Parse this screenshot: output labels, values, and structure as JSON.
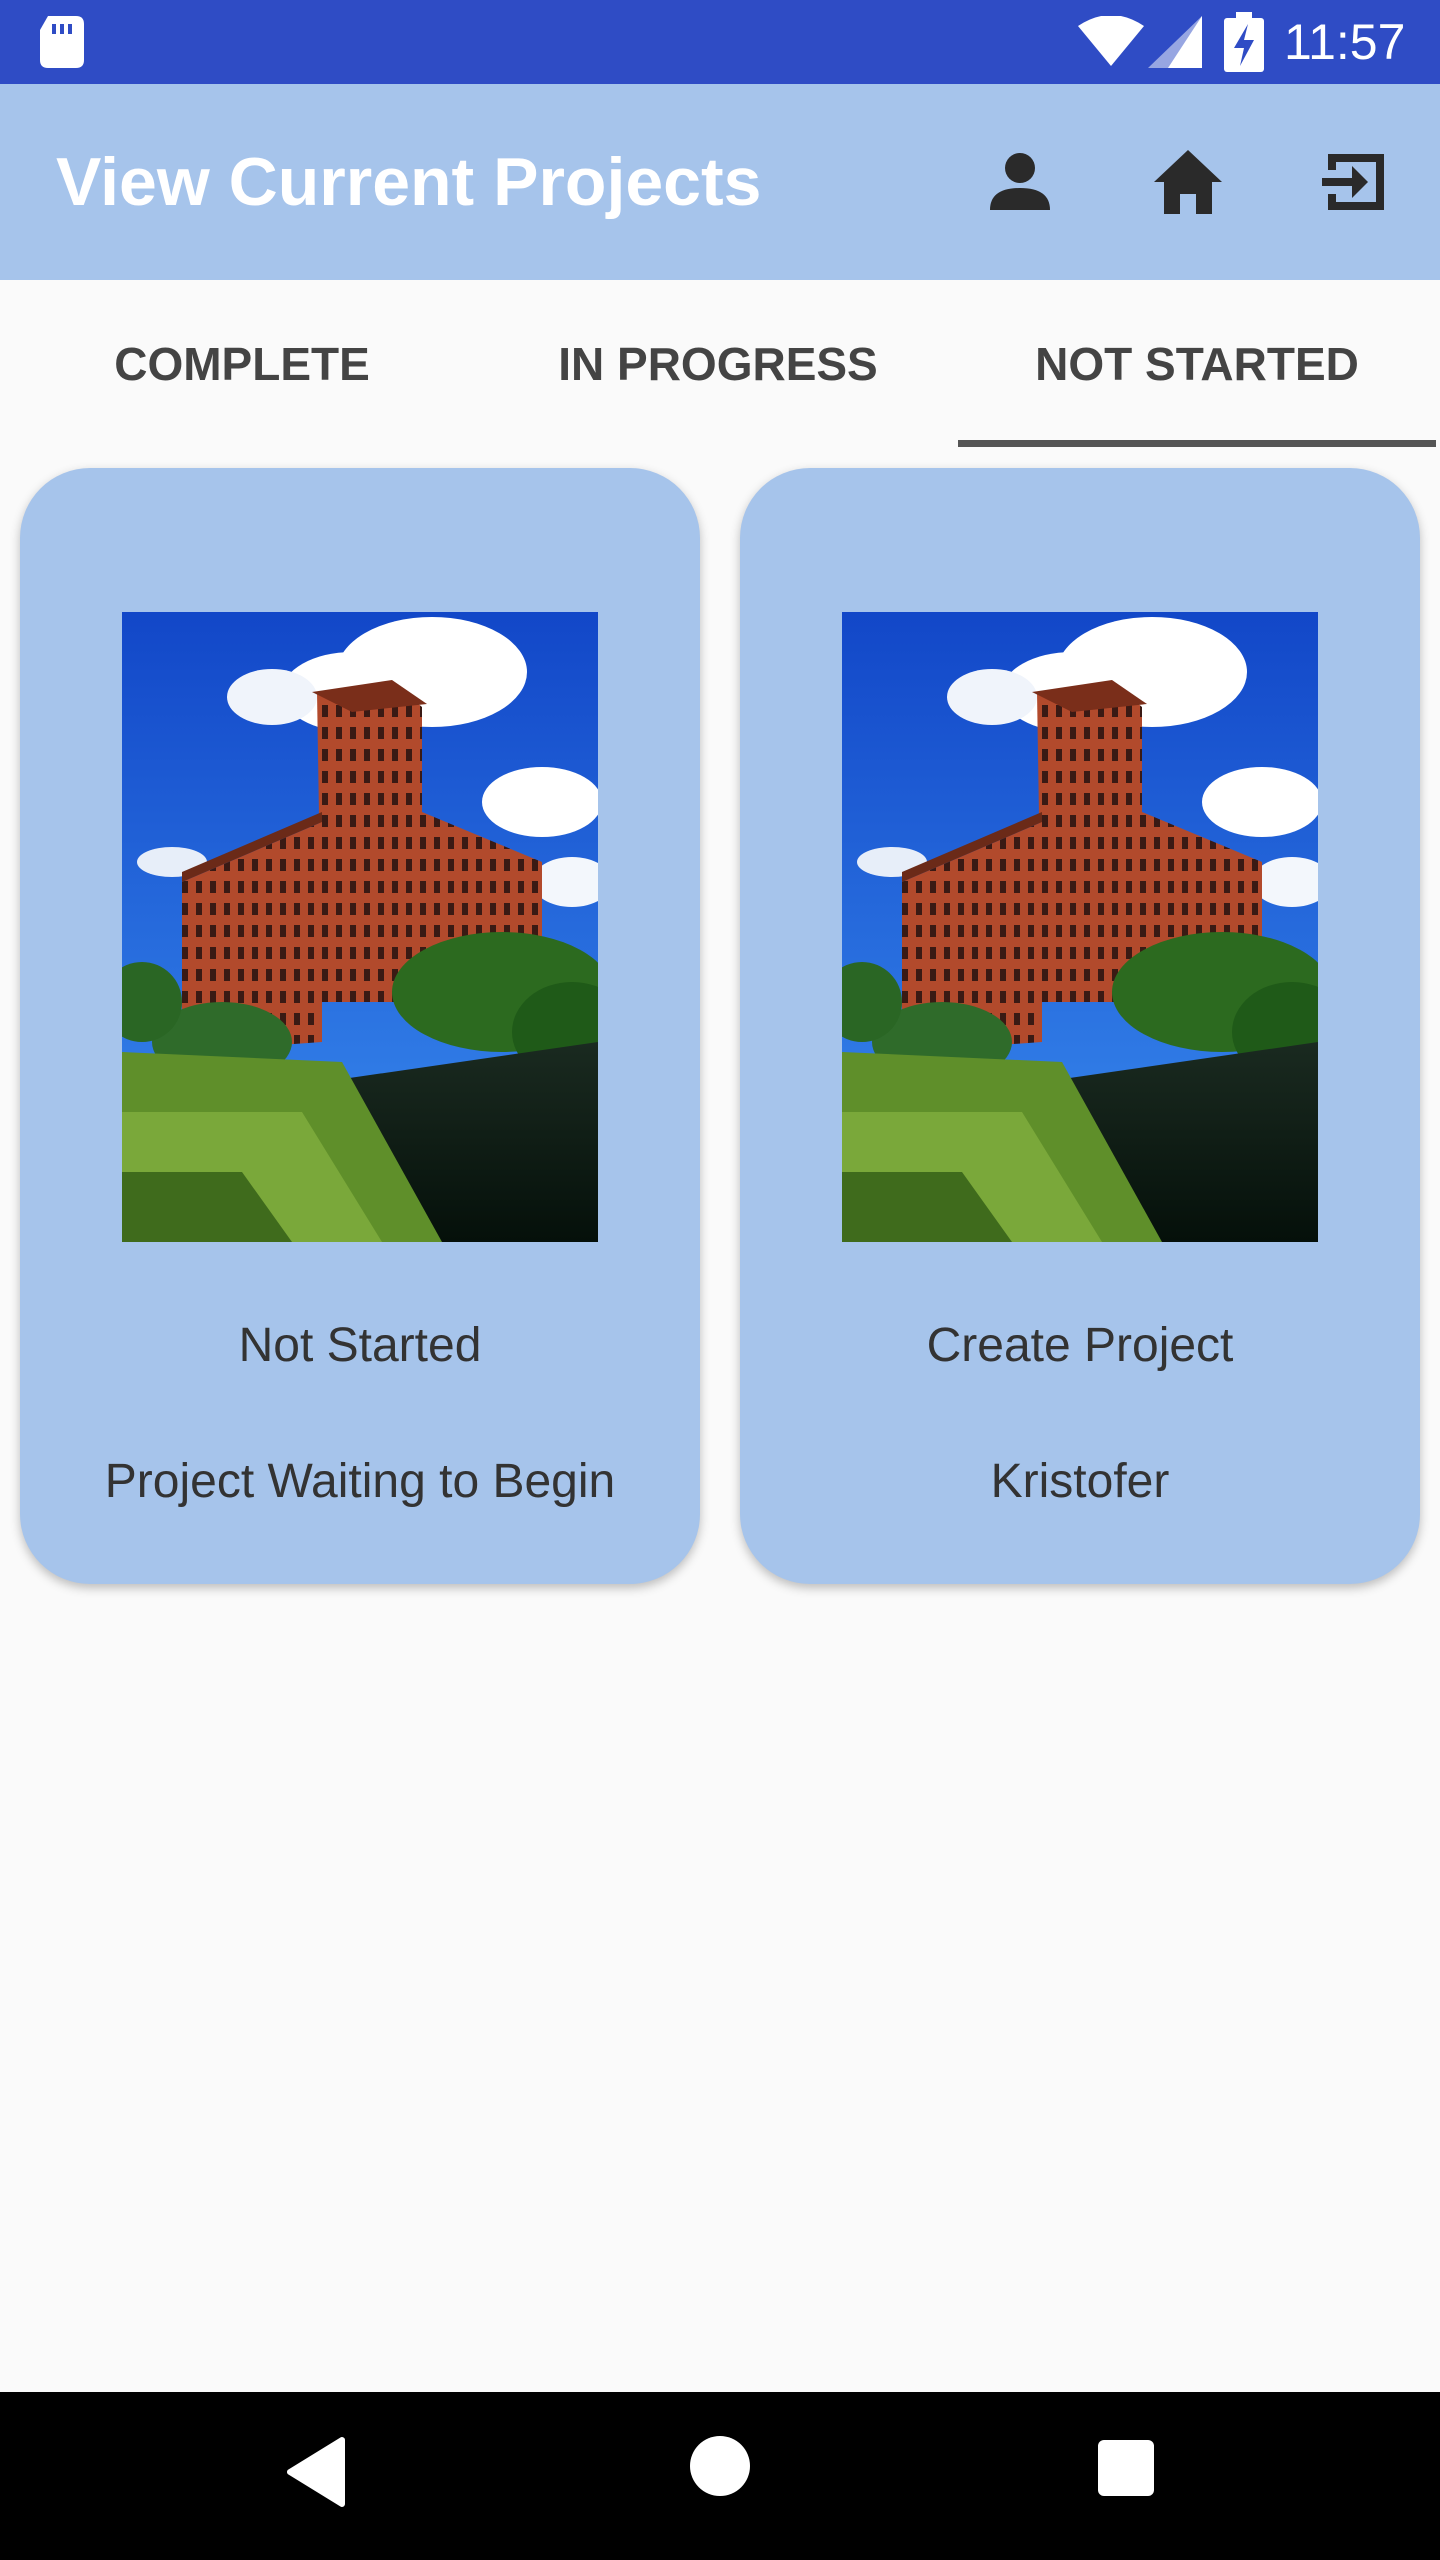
{
  "status_bar": {
    "time": "11:57",
    "icons": [
      "sd-card-icon",
      "wifi-icon",
      "signal-icon",
      "battery-charging-icon"
    ]
  },
  "app_bar": {
    "title": "View Current Projects",
    "actions": [
      "person-icon",
      "home-icon",
      "exit-icon"
    ],
    "background_color": "#a6c4eb"
  },
  "tabs": {
    "items": [
      {
        "label": "COMPLETE"
      },
      {
        "label": "IN PROGRESS"
      },
      {
        "label": "NOT STARTED"
      }
    ],
    "selected": "NOT STARTED"
  },
  "cards": [
    {
      "image": "building-photo",
      "title": "Not Started",
      "subtitle": "Project Waiting to Begin"
    },
    {
      "image": "building-photo",
      "title": "Create Project",
      "subtitle": "Kristofer"
    }
  ],
  "nav_bar": {
    "icons": [
      "back-icon",
      "home-circle-icon",
      "recents-icon"
    ]
  },
  "colors": {
    "status_bar": "#2f4cc5",
    "accent": "#a6c4eb",
    "text": "#333333"
  }
}
